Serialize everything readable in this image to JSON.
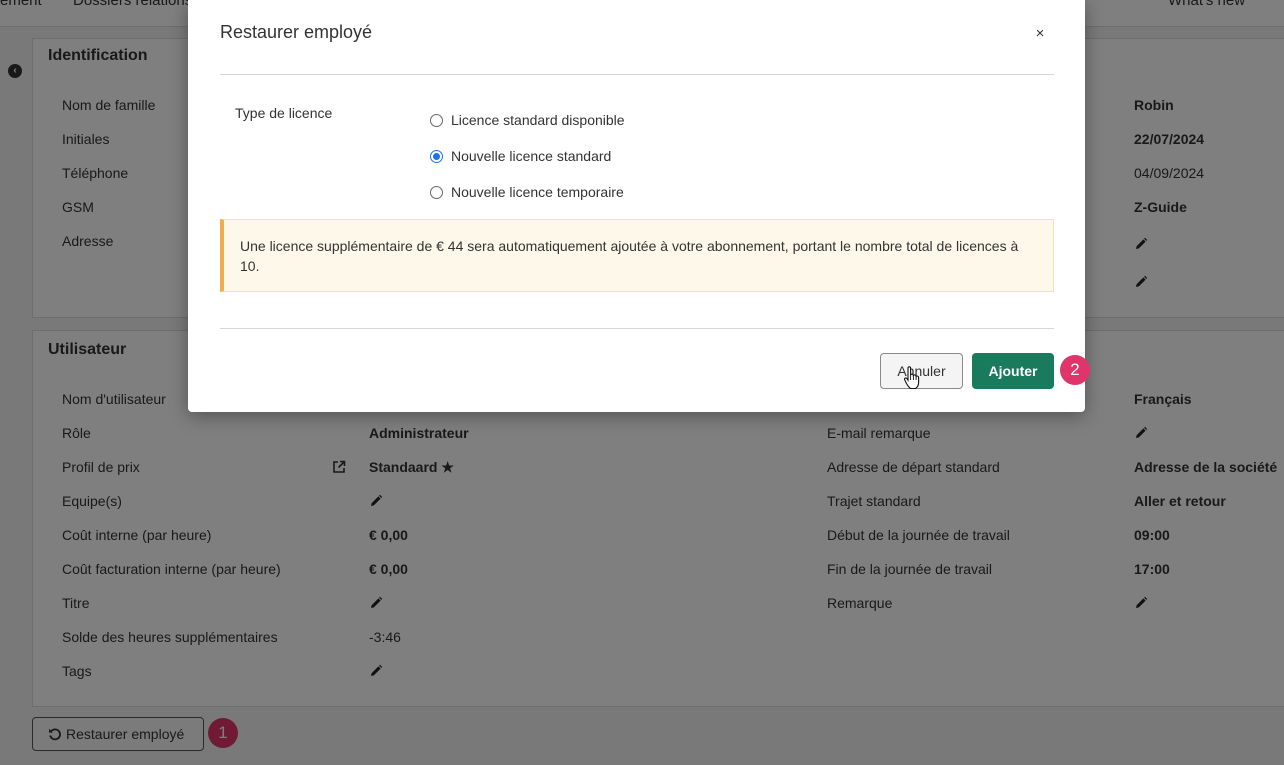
{
  "topbar": {
    "left_item_1": "ement",
    "left_item_2": "Dossiers relations",
    "right_item": "What's new"
  },
  "identification": {
    "title": "Identification",
    "fields": [
      {
        "label": "Nom de famille",
        "value": "Robin"
      },
      {
        "label": "Initiales",
        "value": "22/07/2024"
      },
      {
        "label": "Téléphone",
        "value": "04/09/2024"
      },
      {
        "label": "GSM",
        "value": "Z-Guide"
      },
      {
        "label": "Adresse",
        "value": ""
      }
    ]
  },
  "utilisateur": {
    "title": "Utilisateur",
    "left_fields": [
      {
        "label": "Nom d'utilisateur",
        "value": ""
      },
      {
        "label": "Rôle",
        "value": "Administrateur"
      },
      {
        "label": "Profil de prix",
        "value": "Standaard ★"
      },
      {
        "label": "Equipe(s)",
        "value": ""
      },
      {
        "label": "Coût interne (par heure)",
        "value": "€ 0,00"
      },
      {
        "label": "Coût facturation interne (par heure)",
        "value": "€ 0,00"
      },
      {
        "label": "Titre",
        "value": ""
      },
      {
        "label": "Solde des heures supplémentaires",
        "value": "-3:46"
      },
      {
        "label": "Tags",
        "value": ""
      }
    ],
    "right_fields": [
      {
        "label": "",
        "value": "Français"
      },
      {
        "label": "E-mail remarque",
        "value": ""
      },
      {
        "label": "Adresse de départ standard",
        "value": "Adresse de la société"
      },
      {
        "label": "Trajet standard",
        "value": "Aller et retour"
      },
      {
        "label": "Début de la journée de travail",
        "value": "09:00"
      },
      {
        "label": "Fin de la journée de travail",
        "value": "17:00"
      },
      {
        "label": "Remarque",
        "value": ""
      }
    ]
  },
  "restore_button": {
    "label": "Restaurer employé"
  },
  "badges": {
    "one": "1",
    "two": "2"
  },
  "modal": {
    "title": "Restaurer employé",
    "close": "×",
    "field_label": "Type de licence",
    "options": [
      {
        "label": "Licence standard disponible",
        "selected": false
      },
      {
        "label": "Nouvelle licence standard",
        "selected": true
      },
      {
        "label": "Nouvelle licence temporaire",
        "selected": false
      }
    ],
    "alert": "Une licence supplémentaire de € 44 sera automatiquement ajoutée à votre abonnement, portant le nombre total de licences à 10.",
    "cancel_label": "Annuler",
    "add_label": "Ajouter"
  },
  "colors": {
    "primary": "#1a7a5c",
    "badge": "#e0356a",
    "alert_border": "#f0ad4e",
    "alert_bg": "#fdf8ea",
    "radio": "#1a73e8"
  },
  "icons": [
    "back-icon",
    "pencil-icon",
    "external-link-icon",
    "star-icon",
    "undo-icon",
    "close-icon",
    "hand-cursor-icon"
  ]
}
